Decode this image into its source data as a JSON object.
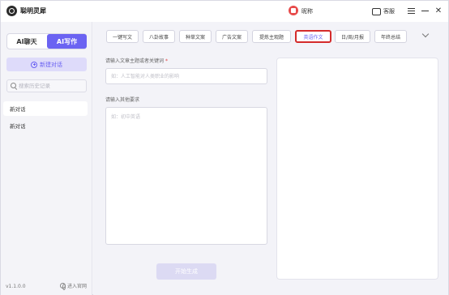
{
  "app": {
    "title": "聪明灵犀",
    "user_name": "昵称",
    "support_label": "客服"
  },
  "sidebar": {
    "mode_chat": "AI聊天",
    "mode_write": "AI写作",
    "new_chat": "新建对话",
    "search_placeholder": "搜索历史记录",
    "conversations": [
      "新对话",
      "新对话"
    ],
    "version": "v1.1.0.0",
    "homepage": "进入官网"
  },
  "main": {
    "tabs": [
      {
        "label": "一键写文",
        "active": false
      },
      {
        "label": "八卦故事",
        "active": false
      },
      {
        "label": "种草文案",
        "active": false
      },
      {
        "label": "广告文案",
        "active": false
      },
      {
        "label": "提炼主观题",
        "active": false
      },
      {
        "label": "英语作文",
        "active": true
      },
      {
        "label": "日/周/月报",
        "active": false
      },
      {
        "label": "年终总结",
        "active": false
      }
    ],
    "topic_label": "请输入文章主题或者关键词",
    "topic_required_mark": "*",
    "topic_placeholder": "如：人工智能对人类职业的影响",
    "other_label": "请输入其他要求",
    "other_placeholder": "如：初中英语",
    "generate": "开始生成"
  },
  "colors": {
    "accent": "#6b63f2",
    "highlight_border": "#d42b2b"
  }
}
